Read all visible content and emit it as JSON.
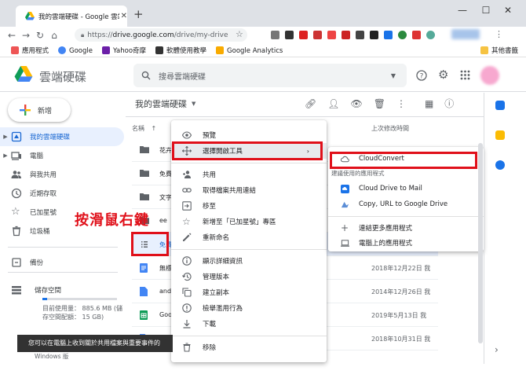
{
  "browser": {
    "tab_title": "我的雲端硬碟 - Google 雲端硬碟",
    "url_scheme": "https://",
    "url_host": "drive.google.com",
    "url_path": "/drive/my-drive",
    "bookmarks": [
      "應用程式",
      "Google",
      "Yahoo奇摩",
      "軟體使用教學",
      "Google Analytics"
    ],
    "other_bookmarks": "其他書籤"
  },
  "app": {
    "name": "雲端硬碟",
    "search_placeholder": "搜尋雲端硬碟"
  },
  "sidebar": {
    "new_label": "新增",
    "items": [
      {
        "label": "我的雲端硬碟",
        "icon": "drive-icon",
        "active": true
      },
      {
        "label": "電腦",
        "icon": "computer-icon"
      },
      {
        "label": "與我共用",
        "icon": "shared-icon"
      },
      {
        "label": "近期存取",
        "icon": "clock-icon"
      },
      {
        "label": "已加星號",
        "icon": "star-icon"
      },
      {
        "label": "垃圾桶",
        "icon": "trash-icon"
      }
    ],
    "backup_label": "備份",
    "storage_label": "儲存空間",
    "storage_used": "目前使用量： 885.6 MB (儲",
    "storage_total": "存空間配額： 15 GB)",
    "storage_fraction": 0.06
  },
  "main": {
    "title": "我的雲端硬碟",
    "col_name": "名稱",
    "col_modified": "上次修改時間",
    "files": [
      {
        "name": "花卉",
        "type": "folder",
        "modified": ""
      },
      {
        "name": "免費",
        "type": "folder",
        "modified": ""
      },
      {
        "name": "文字",
        "type": "folder",
        "modified": ""
      },
      {
        "name": "ee",
        "type": "folder",
        "modified": ""
      },
      {
        "name": "免費",
        "type": "form",
        "modified": ""
      },
      {
        "name": "無標",
        "type": "doc",
        "modified": "2018年12月22日 我"
      },
      {
        "name": "and",
        "type": "file",
        "modified": "2014年12月26日 我"
      },
      {
        "name": "Goo",
        "type": "sheet",
        "modified": "2019年5月13日 我"
      },
      {
        "name": "",
        "type": "file",
        "modified": "2018年10月31日 我"
      }
    ]
  },
  "annotation": "按滑鼠右鍵",
  "context_menu": [
    {
      "label": "預覽",
      "icon": "eye-icon"
    },
    {
      "label": "選擇開啟工具",
      "icon": "move-arrows-icon",
      "has_sub": true
    },
    {
      "label": "共用",
      "icon": "add-person-icon"
    },
    {
      "label": "取得檔案共用連結",
      "icon": "link-icon"
    },
    {
      "label": "移至",
      "icon": "move-to-icon"
    },
    {
      "label": "新增至「已加星號」專區",
      "icon": "star-icon"
    },
    {
      "label": "重新命名",
      "icon": "pencil-icon"
    },
    {
      "label": "顯示詳細資訊",
      "icon": "info-icon"
    },
    {
      "label": "管理版本",
      "icon": "history-icon"
    },
    {
      "label": "建立副本",
      "icon": "copy-icon"
    },
    {
      "label": "檢舉濫用行為",
      "icon": "report-icon"
    },
    {
      "label": "下載",
      "icon": "download-icon"
    },
    {
      "label": "移除",
      "icon": "trash-icon"
    }
  ],
  "submenu": {
    "top_item": "CloudConvert",
    "recent_header": "建議使用的應用程式",
    "recent": [
      "Cloud Drive to Mail",
      "Copy, URL to Google Drive"
    ],
    "connect": "連結更多應用程式",
    "desktop": "電腦上的應用程式"
  },
  "snackbar": "您可以在電腦上收到關於共用檔案與重要事件的",
  "snackbar_line2": "Windows 版",
  "colors": {
    "accent": "#1a73e8",
    "annotation": "#e0101a",
    "nav_active_bg": "#e8f0fe"
  }
}
